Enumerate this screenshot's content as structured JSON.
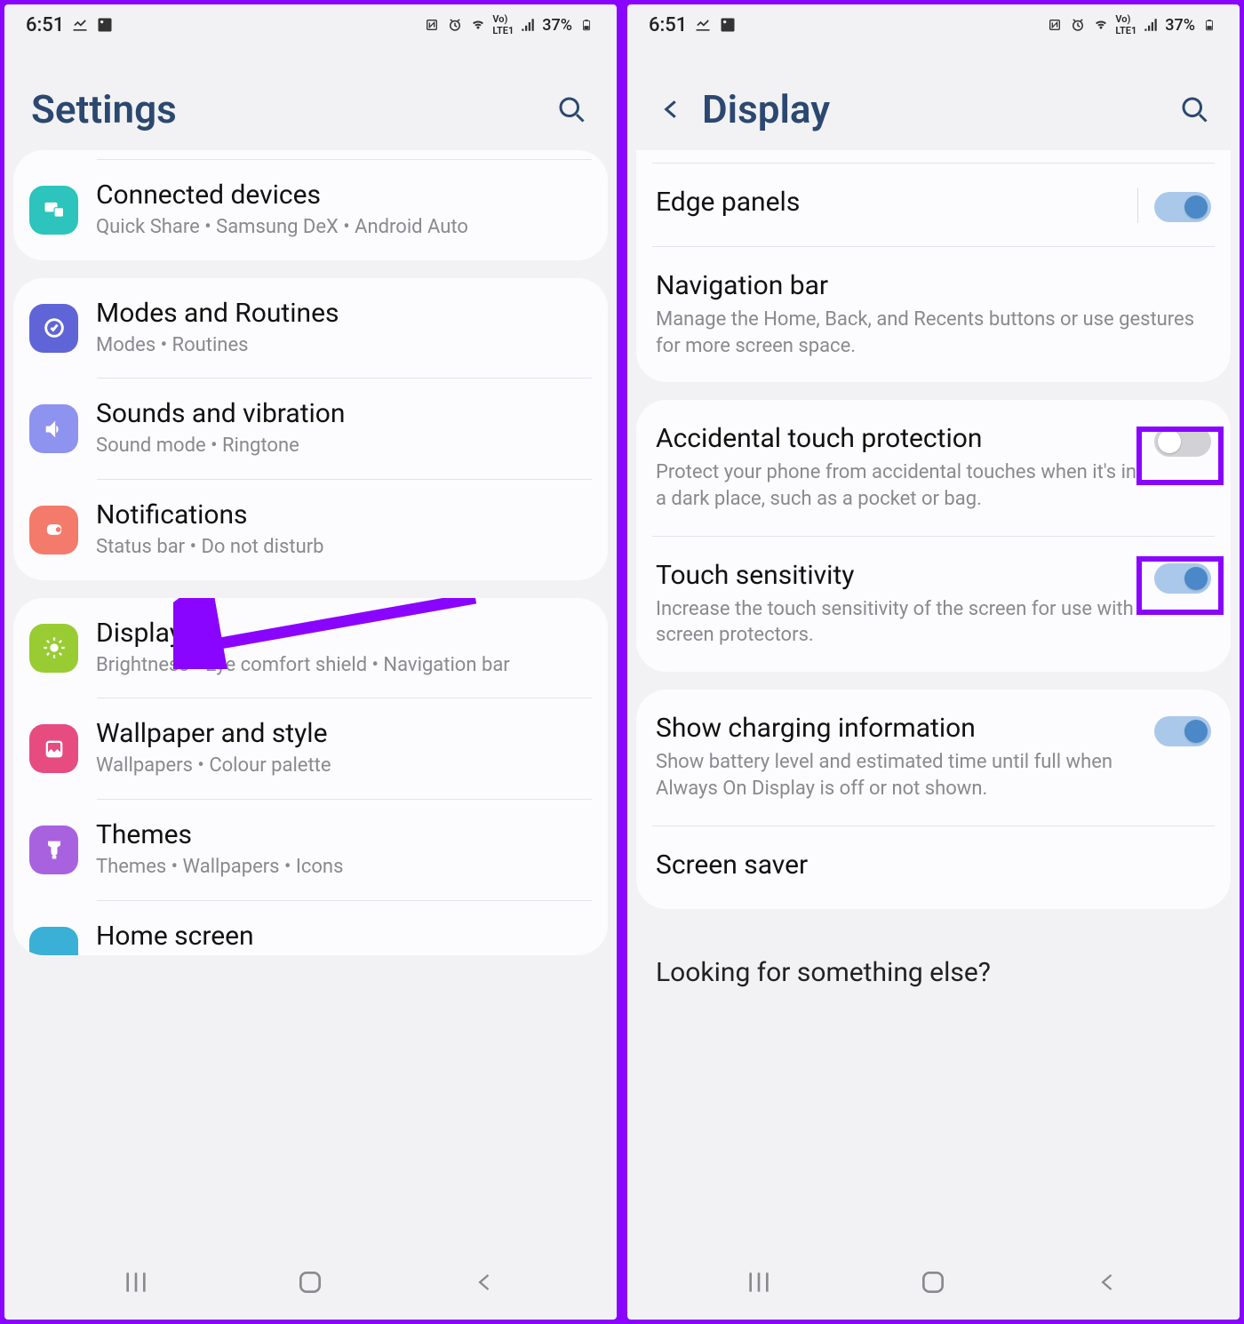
{
  "statusBar": {
    "time": "6:51",
    "battery": "37%"
  },
  "left": {
    "headerTitle": "Settings",
    "items": {
      "connectedDevices": {
        "title": "Connected devices",
        "sub": "Quick Share  •  Samsung DeX  •  Android Auto",
        "iconColor": "#2cc4bd"
      },
      "modes": {
        "title": "Modes and Routines",
        "sub": "Modes  •  Routines",
        "iconColor": "#5f65d6"
      },
      "sounds": {
        "title": "Sounds and vibration",
        "sub": "Sound mode  •  Ringtone",
        "iconColor": "#8e93f0"
      },
      "notifications": {
        "title": "Notifications",
        "sub": "Status bar  •  Do not disturb",
        "iconColor": "#f47a6b"
      },
      "display": {
        "title": "Display",
        "sub": "Brightness  •  Eye comfort shield  •  Navigation bar",
        "iconColor": "#99cc33"
      },
      "wallpaper": {
        "title": "Wallpaper and style",
        "sub": "Wallpapers  •  Colour palette",
        "iconColor": "#e64c80"
      },
      "themes": {
        "title": "Themes",
        "sub": "Themes  •  Wallpapers  •  Icons",
        "iconColor": "#a862e0"
      },
      "home": {
        "title": "Home screen",
        "sub": ""
      }
    }
  },
  "right": {
    "headerTitle": "Display",
    "edgePanels": {
      "title": "Edge panels",
      "on": true
    },
    "navBar": {
      "title": "Navigation bar",
      "sub": "Manage the Home, Back, and Recents buttons or use gestures for more screen space."
    },
    "accidental": {
      "title": "Accidental touch protection",
      "sub": "Protect your phone from accidental touches when it's in a dark place, such as a pocket or bag.",
      "on": false
    },
    "touchSens": {
      "title": "Touch sensitivity",
      "sub": "Increase the touch sensitivity of the screen for use with screen protectors.",
      "on": true
    },
    "charging": {
      "title": "Show charging information",
      "sub": "Show battery level and estimated time until full when Always On Display is off or not shown.",
      "on": true
    },
    "screenSaver": {
      "title": "Screen saver"
    },
    "looking": "Looking for something else?"
  }
}
